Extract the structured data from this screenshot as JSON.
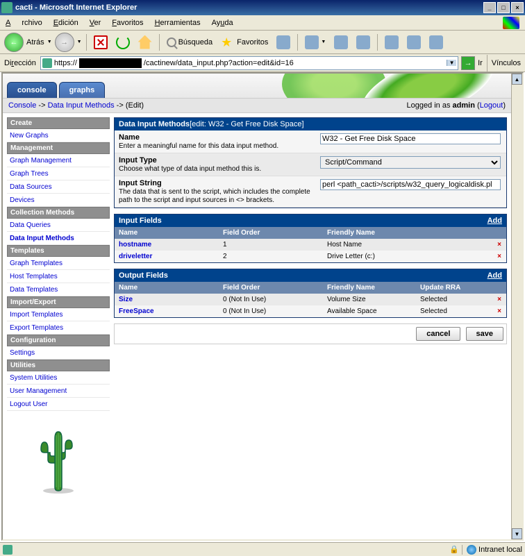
{
  "window": {
    "title": "cacti - Microsoft Internet Explorer"
  },
  "menu": {
    "archivo": "Archivo",
    "edicion": "Edición",
    "ver": "Ver",
    "favoritos": "Favoritos",
    "herramientas": "Herramientas",
    "ayuda": "Ayuda"
  },
  "toolbar": {
    "back": "Atrás",
    "search": "Búsqueda",
    "favorites": "Favoritos"
  },
  "address": {
    "label": "Dirección",
    "url_prefix": "https://",
    "url_suffix": "/cactinew/data_input.php?action=edit&id=16",
    "go": "Ir",
    "links": "Vínculos"
  },
  "tabs": {
    "console": "console",
    "graphs": "graphs"
  },
  "breadcrumb": {
    "console": "Console",
    "arrow1": " -> ",
    "dim": "Data Input Methods",
    "arrow2": " -> ",
    "edit": "(Edit)",
    "logged_prefix": "Logged in as ",
    "user": "admin",
    "logout": "Logout"
  },
  "sidebar": {
    "groups": [
      {
        "header": "Create",
        "items": [
          {
            "label": "New Graphs"
          }
        ]
      },
      {
        "header": "Management",
        "items": [
          {
            "label": "Graph Management"
          },
          {
            "label": "Graph Trees"
          },
          {
            "label": "Data Sources"
          },
          {
            "label": "Devices"
          }
        ]
      },
      {
        "header": "Collection Methods",
        "items": [
          {
            "label": "Data Queries"
          },
          {
            "label": "Data Input Methods",
            "active": true
          }
        ]
      },
      {
        "header": "Templates",
        "items": [
          {
            "label": "Graph Templates"
          },
          {
            "label": "Host Templates"
          },
          {
            "label": "Data Templates"
          }
        ]
      },
      {
        "header": "Import/Export",
        "items": [
          {
            "label": "Import Templates"
          },
          {
            "label": "Export Templates"
          }
        ]
      },
      {
        "header": "Configuration",
        "items": [
          {
            "label": "Settings"
          }
        ]
      },
      {
        "header": "Utilities",
        "items": [
          {
            "label": "System Utilities"
          },
          {
            "label": "User Management"
          },
          {
            "label": "Logout User"
          }
        ]
      }
    ]
  },
  "panel_dim": {
    "title": "Data Input Methods",
    "subtitle": " [edit: W32 - Get Free Disk Space]",
    "rows": {
      "name": {
        "label": "Name",
        "desc": "Enter a meaningful name for this data input method.",
        "value": "W32 - Get Free Disk Space"
      },
      "type": {
        "label": "Input Type",
        "desc": "Choose what type of data input method this is.",
        "value": "Script/Command"
      },
      "string": {
        "label": "Input String",
        "desc": "The data that is sent to the script, which includes the complete path to the script and input sources in <> brackets.",
        "value": "perl <path_cacti>/scripts/w32_query_logicaldisk.pl"
      }
    }
  },
  "panel_input": {
    "title": "Input Fields",
    "add": "Add",
    "headers": {
      "name": "Name",
      "order": "Field Order",
      "friendly": "Friendly Name"
    },
    "rows": [
      {
        "name": "hostname",
        "order": "1",
        "friendly": "Host Name"
      },
      {
        "name": "driveletter",
        "order": "2",
        "friendly": "Drive Letter (c:)"
      }
    ]
  },
  "panel_output": {
    "title": "Output Fields",
    "add": "Add",
    "headers": {
      "name": "Name",
      "order": "Field Order",
      "friendly": "Friendly Name",
      "update": "Update RRA"
    },
    "rows": [
      {
        "name": "Size",
        "order": "0 (Not In Use)",
        "friendly": "Volume Size",
        "update": "Selected"
      },
      {
        "name": "FreeSpace",
        "order": "0 (Not In Use)",
        "friendly": "Available Space",
        "update": "Selected"
      }
    ]
  },
  "actions": {
    "cancel": "cancel",
    "save": "save"
  },
  "status": {
    "zone": "Intranet local"
  }
}
